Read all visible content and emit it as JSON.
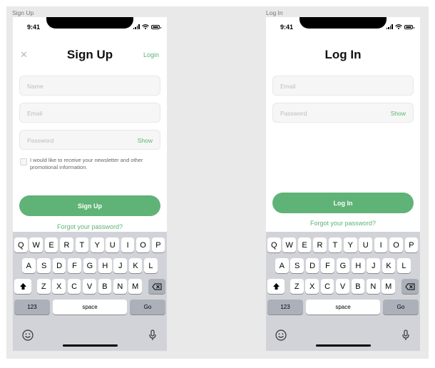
{
  "frames": [
    {
      "id": "signup",
      "frame_label": "Sign Up",
      "time": "9:41",
      "title": "Sign Up",
      "close_icon": "close-icon",
      "top_link": "Login",
      "fields": [
        {
          "placeholder": "Name"
        },
        {
          "placeholder": "Email"
        },
        {
          "placeholder": "Password",
          "action": "Show"
        }
      ],
      "checkbox_label": "I would like to receive your newsletter and other promotional information.",
      "primary_button": "Sign Up",
      "forgot_link": "Forgot your password?"
    },
    {
      "id": "login",
      "frame_label": "Log In",
      "time": "9:41",
      "title": "Log In",
      "fields": [
        {
          "placeholder": "Email"
        },
        {
          "placeholder": "Password",
          "action": "Show"
        }
      ],
      "primary_button": "Log In",
      "forgot_link": "Forgot your password?"
    }
  ],
  "keyboard": {
    "row1": [
      "Q",
      "W",
      "E",
      "R",
      "T",
      "Y",
      "U",
      "I",
      "O",
      "P"
    ],
    "row2": [
      "A",
      "S",
      "D",
      "F",
      "G",
      "H",
      "J",
      "K",
      "L"
    ],
    "row3": [
      "Z",
      "X",
      "C",
      "V",
      "B",
      "N",
      "M"
    ],
    "numbers_key": "123",
    "space_key": "space",
    "go_key": "Go",
    "icons": [
      "shift-icon",
      "backspace-icon",
      "emoji-icon",
      "microphone-icon"
    ]
  },
  "colors": {
    "accent": "#5bb374",
    "button": "#5fb376",
    "canvas": "#e9e9e9",
    "keyboard_bg": "#d1d3d9",
    "key_dark": "#abb0b9"
  }
}
